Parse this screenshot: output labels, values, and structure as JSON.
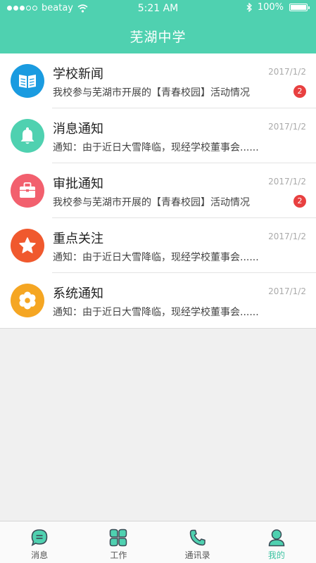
{
  "status_bar": {
    "carrier": "beatay",
    "time": "5:21 AM",
    "battery": "100%"
  },
  "header": {
    "title": "芜湖中学"
  },
  "colors": {
    "header_bg": "#4fd1b0",
    "badge": "#e84040",
    "tab_active": "#3cc3a1"
  },
  "messages": [
    {
      "title": "学校新闻",
      "date": "2017/1/2",
      "subtitle": "我校参与芜湖市开展的【青春校园】活动情况",
      "badge": "2",
      "icon": "book-icon",
      "color": "#1a9be0"
    },
    {
      "title": "消息通知",
      "date": "2017/1/2",
      "subtitle": "通知：由于近日大雪降临，现经学校董事会......",
      "badge": "",
      "icon": "bell-icon",
      "color": "#4fd1b0"
    },
    {
      "title": "审批通知",
      "date": "2017/1/2",
      "subtitle": "我校参与芜湖市开展的【青春校园】活动情况",
      "badge": "2",
      "icon": "briefcase-icon",
      "color": "#f2606e"
    },
    {
      "title": "重点关注",
      "date": "2017/1/2",
      "subtitle": "通知：由于近日大雪降临，现经学校董事会......",
      "badge": "",
      "icon": "star-icon",
      "color": "#f0592e"
    },
    {
      "title": "系统通知",
      "date": "2017/1/2",
      "subtitle": "通知：由于近日大雪降临，现经学校董事会......",
      "badge": "",
      "icon": "gear-icon",
      "color": "#f5a623"
    }
  ],
  "tabs": [
    {
      "label": "消息",
      "icon": "chat-icon",
      "active": false
    },
    {
      "label": "工作",
      "icon": "clover-icon",
      "active": false
    },
    {
      "label": "通讯录",
      "icon": "phone-icon",
      "active": false
    },
    {
      "label": "我的",
      "icon": "user-icon",
      "active": true
    }
  ]
}
